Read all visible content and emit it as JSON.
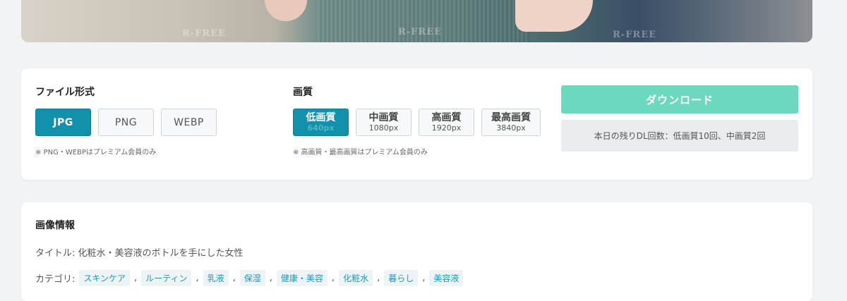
{
  "photo": {
    "watermarks": [
      "R-FREE",
      "R-FREE",
      "R-FREE"
    ]
  },
  "format": {
    "title": "ファイル形式",
    "options": [
      {
        "label": "JPG",
        "active": true
      },
      {
        "label": "PNG",
        "active": false
      },
      {
        "label": "WEBP",
        "active": false
      }
    ],
    "note": "※ PNG・WEBPはプレミアム会員のみ"
  },
  "quality": {
    "title": "画質",
    "options": [
      {
        "label": "低画質",
        "resolution": "640px",
        "active": true
      },
      {
        "label": "中画質",
        "resolution": "1080px",
        "active": false
      },
      {
        "label": "高画質",
        "resolution": "1920px",
        "active": false
      },
      {
        "label": "最高画質",
        "resolution": "3840px",
        "active": false
      }
    ],
    "note": "※ 高画質・最高画質はプレミアム会員のみ"
  },
  "download": {
    "button_label": "ダウンロード",
    "remaining_text": "本日の残りDL回数：低画質10回、中画質2回"
  },
  "info": {
    "title": "画像情報",
    "title_row": "タイトル: 化粧水・美容液のボトルを手にした女性",
    "category_label": "カテゴリ:",
    "categories": [
      "スキンケア",
      "ルーティン",
      "乳液",
      "保湿",
      "健康・美容",
      "化粧水",
      "暮らし",
      "美容液"
    ],
    "separator": ","
  },
  "colors": {
    "accent": "#1291ad",
    "download": "#6cd8be",
    "tag_text": "#1b9ab6"
  }
}
